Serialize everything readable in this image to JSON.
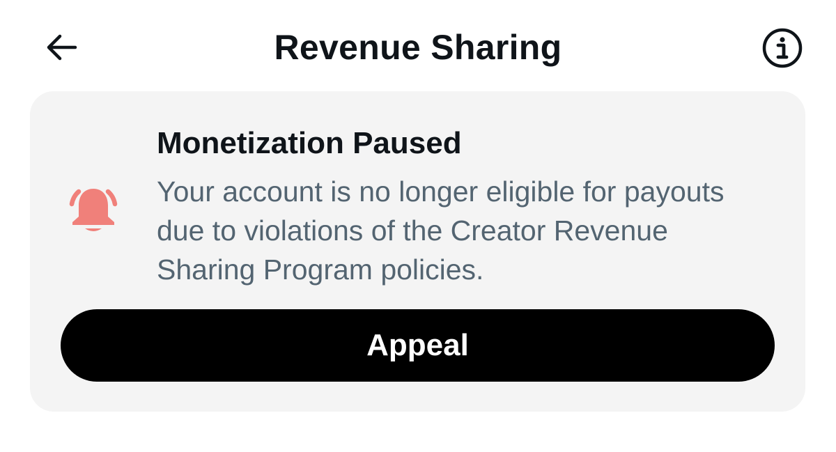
{
  "header": {
    "title": "Revenue Sharing",
    "back_icon": "back-arrow-icon",
    "info_icon": "info-icon"
  },
  "notice": {
    "icon": "alert-bell-icon",
    "title": "Monetization Paused",
    "body": "Your account is no longer eligible for payouts due to violations of the Creator Revenue Sharing Program policies.",
    "button_label": "Appeal"
  },
  "colors": {
    "alert_icon": "#f0807a",
    "card_background": "#f4f4f4",
    "button_background": "#000000",
    "body_text": "#536471"
  }
}
